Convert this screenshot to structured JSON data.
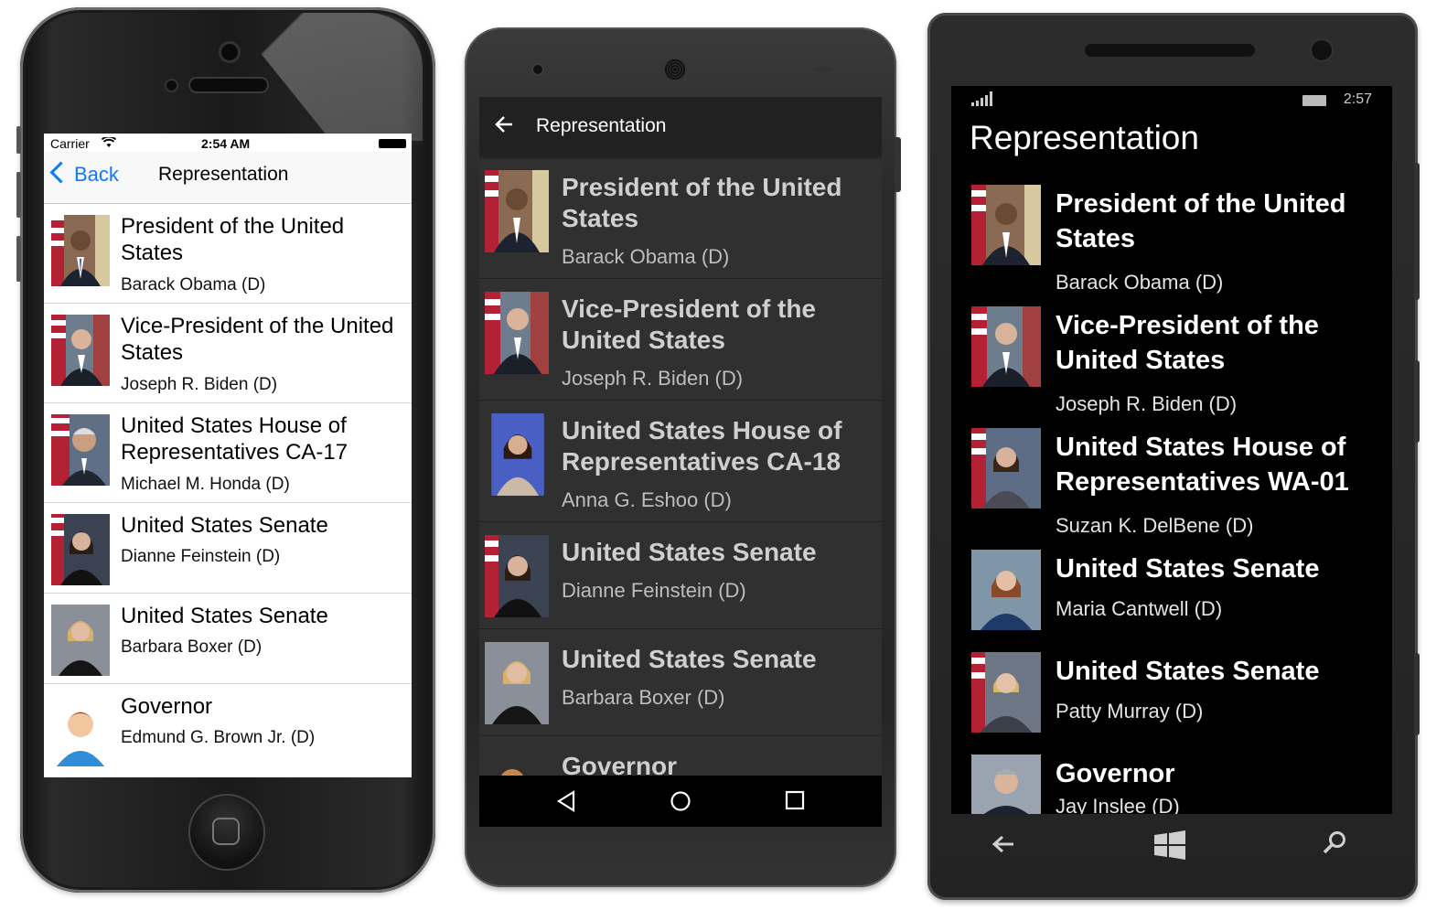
{
  "ios": {
    "carrier": "Carrier",
    "time": "2:54 AM",
    "back_label": "Back",
    "title": "Representation",
    "rows": [
      {
        "title": "President of the United States",
        "name": "Barack Obama (D)"
      },
      {
        "title": "Vice-President of the United States",
        "name": "Joseph R. Biden (D)"
      },
      {
        "title": "United States House of Representatives CA-17",
        "name": "Michael M. Honda (D)"
      },
      {
        "title": "United States Senate",
        "name": "Dianne Feinstein (D)"
      },
      {
        "title": "United States Senate",
        "name": "Barbara Boxer (D)"
      },
      {
        "title": "Governor",
        "name": "Edmund G. Brown Jr. (D)"
      }
    ]
  },
  "android": {
    "title": "Representation",
    "rows": [
      {
        "title": "President of the United States",
        "name": "Barack Obama (D)"
      },
      {
        "title": "Vice-President of the United States",
        "name": "Joseph R. Biden (D)"
      },
      {
        "title": "United States House of Representatives CA-18",
        "name": "Anna G. Eshoo (D)"
      },
      {
        "title": "United States Senate",
        "name": "Dianne Feinstein (D)"
      },
      {
        "title": "United States Senate",
        "name": "Barbara Boxer (D)"
      },
      {
        "title": "Governor",
        "name": ""
      }
    ]
  },
  "windows": {
    "time": "2:57",
    "title": "Representation",
    "rows": [
      {
        "title": "President of the United States",
        "name": "Barack Obama (D)"
      },
      {
        "title": "Vice-President of the United States",
        "name": "Joseph R. Biden (D)"
      },
      {
        "title": "United States House of Representatives WA-01",
        "name": "Suzan K. DelBene (D)"
      },
      {
        "title": "United States Senate",
        "name": "Maria Cantwell (D)"
      },
      {
        "title": "United States Senate",
        "name": "Patty Murray (D)"
      },
      {
        "title": "Governor",
        "name": "Jay Inslee (D)"
      }
    ]
  },
  "colors": {
    "ios_accent": "#0a7aff",
    "android_background": "#303030",
    "android_appbar": "#212121",
    "windows_background": "#000000"
  },
  "icons": [
    "wifi-icon",
    "battery-icon",
    "back-chevron-icon",
    "arrow-back-icon",
    "nav-back-icon",
    "nav-home-icon",
    "nav-recents-icon",
    "signal-icon",
    "windows-logo-icon",
    "search-icon",
    "default-avatar-icon"
  ]
}
